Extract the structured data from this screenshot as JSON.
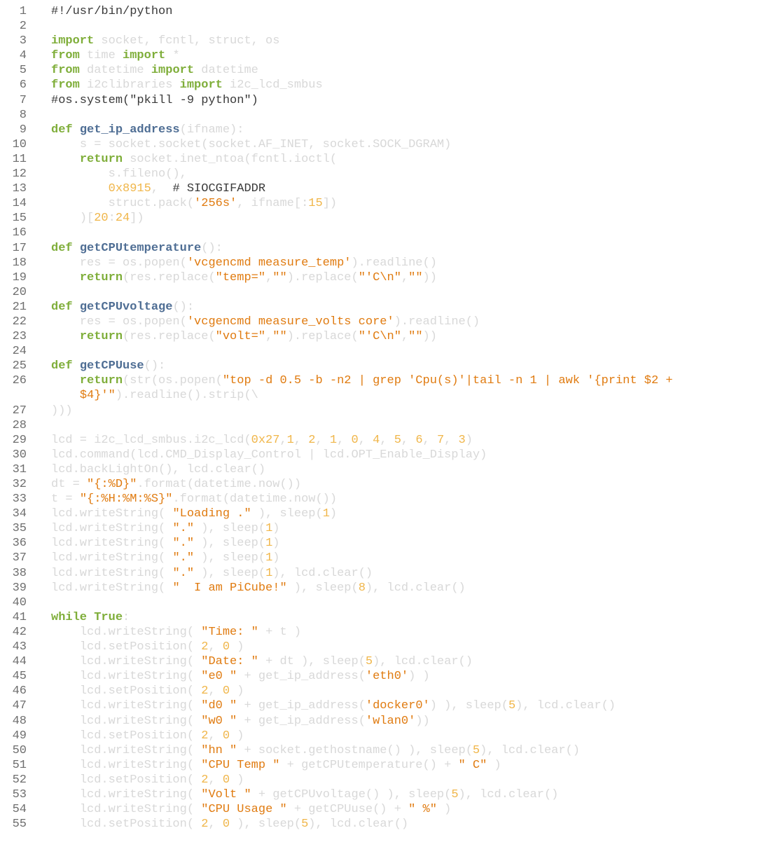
{
  "editor": {
    "colors": {
      "background": "#ffffff",
      "line_number": "#6e6e6e",
      "keyword": "#7fae3a",
      "function_name": "#4f6e94",
      "string": "#e07b10",
      "number": "#f0b64a",
      "comment": "#3a3a3a",
      "plain": "#d8d8d8"
    },
    "lines": [
      {
        "n": "1",
        "indent": 0,
        "t": [
          [
            "#!/usr/bin/python",
            "c"
          ]
        ]
      },
      {
        "n": "2",
        "indent": 0,
        "t": []
      },
      {
        "n": "3",
        "indent": 0,
        "t": [
          [
            "import",
            "k"
          ],
          [
            " socket, fcntl, struct, os",
            "p"
          ]
        ]
      },
      {
        "n": "4",
        "indent": 0,
        "t": [
          [
            "from",
            "k"
          ],
          [
            " time ",
            "p"
          ],
          [
            "import",
            "k"
          ],
          [
            " *",
            "p"
          ]
        ]
      },
      {
        "n": "5",
        "indent": 0,
        "t": [
          [
            "from",
            "k"
          ],
          [
            " datetime ",
            "p"
          ],
          [
            "import",
            "k"
          ],
          [
            " datetime",
            "p"
          ]
        ]
      },
      {
        "n": "6",
        "indent": 0,
        "t": [
          [
            "from",
            "k"
          ],
          [
            " i2clibraries ",
            "p"
          ],
          [
            "import",
            "k"
          ],
          [
            " i2c_lcd_smbus",
            "p"
          ]
        ]
      },
      {
        "n": "7",
        "indent": 0,
        "t": [
          [
            "#os.system(\"pkill -9 python\")",
            "c"
          ]
        ]
      },
      {
        "n": "8",
        "indent": 0,
        "t": []
      },
      {
        "n": "9",
        "indent": 0,
        "t": [
          [
            "def",
            "k"
          ],
          [
            " ",
            "p"
          ],
          [
            "get_ip_address",
            "f"
          ],
          [
            "(ifname):",
            "p"
          ]
        ]
      },
      {
        "n": "10",
        "indent": 4,
        "t": [
          [
            "s = socket.socket(socket.AF_INET, socket.SOCK_DGRAM)",
            "p"
          ]
        ]
      },
      {
        "n": "11",
        "indent": 4,
        "t": [
          [
            "return",
            "k"
          ],
          [
            " socket.inet_ntoa(fcntl.ioctl(",
            "p"
          ]
        ]
      },
      {
        "n": "12",
        "indent": 8,
        "t": [
          [
            "s.fileno(),",
            "p"
          ]
        ]
      },
      {
        "n": "13",
        "indent": 8,
        "t": [
          [
            "0x8915",
            "n"
          ],
          [
            ",  ",
            "p"
          ],
          [
            "# SIOCGIFADDR",
            "c"
          ]
        ]
      },
      {
        "n": "14",
        "indent": 8,
        "t": [
          [
            "struct.pack(",
            "p"
          ],
          [
            "'256s'",
            "s"
          ],
          [
            ", ifname[:",
            "p"
          ],
          [
            "15",
            "n"
          ],
          [
            "])",
            "p"
          ]
        ]
      },
      {
        "n": "15",
        "indent": 4,
        "t": [
          [
            ")[",
            "p"
          ],
          [
            "20",
            "n"
          ],
          [
            ":",
            "p"
          ],
          [
            "24",
            "n"
          ],
          [
            "])",
            "p"
          ]
        ]
      },
      {
        "n": "16",
        "indent": 0,
        "t": []
      },
      {
        "n": "17",
        "indent": 0,
        "t": [
          [
            "def",
            "k"
          ],
          [
            " ",
            "p"
          ],
          [
            "getCPUtemperature",
            "f"
          ],
          [
            "():",
            "p"
          ]
        ]
      },
      {
        "n": "18",
        "indent": 4,
        "t": [
          [
            "res = os.popen(",
            "p"
          ],
          [
            "'vcgencmd measure_temp'",
            "s"
          ],
          [
            ").readline()",
            "p"
          ]
        ]
      },
      {
        "n": "19",
        "indent": 4,
        "t": [
          [
            "return",
            "k"
          ],
          [
            "(res.replace(",
            "p"
          ],
          [
            "\"temp=\"",
            "s"
          ],
          [
            ",",
            "p"
          ],
          [
            "\"\"",
            "s"
          ],
          [
            ").replace(",
            "p"
          ],
          [
            "\"'C\\n\"",
            "s"
          ],
          [
            ",",
            "p"
          ],
          [
            "\"\"",
            "s"
          ],
          [
            "))",
            "p"
          ]
        ]
      },
      {
        "n": "20",
        "indent": 0,
        "t": []
      },
      {
        "n": "21",
        "indent": 0,
        "t": [
          [
            "def",
            "k"
          ],
          [
            " ",
            "p"
          ],
          [
            "getCPUvoltage",
            "f"
          ],
          [
            "():",
            "p"
          ]
        ]
      },
      {
        "n": "22",
        "indent": 4,
        "t": [
          [
            "res = os.popen(",
            "p"
          ],
          [
            "'vcgencmd measure_volts core'",
            "s"
          ],
          [
            ").readline()",
            "p"
          ]
        ]
      },
      {
        "n": "23",
        "indent": 4,
        "t": [
          [
            "return",
            "k"
          ],
          [
            "(res.replace(",
            "p"
          ],
          [
            "\"volt=\"",
            "s"
          ],
          [
            ",",
            "p"
          ],
          [
            "\"\"",
            "s"
          ],
          [
            ").replace(",
            "p"
          ],
          [
            "\"'C\\n\"",
            "s"
          ],
          [
            ",",
            "p"
          ],
          [
            "\"\"",
            "s"
          ],
          [
            "))",
            "p"
          ]
        ]
      },
      {
        "n": "24",
        "indent": 0,
        "t": []
      },
      {
        "n": "25",
        "indent": 0,
        "t": [
          [
            "def",
            "k"
          ],
          [
            " ",
            "p"
          ],
          [
            "getCPUuse",
            "f"
          ],
          [
            "():",
            "p"
          ]
        ]
      },
      {
        "n": "26",
        "indent": 4,
        "t": [
          [
            "return",
            "k"
          ],
          [
            "(str(os.popen(",
            "p"
          ],
          [
            "\"top -d 0.5 -b -n2 | grep 'Cpu(s)'|tail -n 1 | awk '{print $2 +",
            "s"
          ]
        ]
      },
      {
        "n": "",
        "indent": 4,
        "t": [
          [
            "$4}'\"",
            "s"
          ],
          [
            ").readline().strip(\\",
            "p"
          ]
        ]
      },
      {
        "n": "27",
        "indent": 0,
        "t": [
          [
            ")))",
            "p"
          ]
        ]
      },
      {
        "n": "28",
        "indent": 0,
        "t": []
      },
      {
        "n": "29",
        "indent": 0,
        "t": [
          [
            "lcd = i2c_lcd_smbus.i2c_lcd(",
            "p"
          ],
          [
            "0x27",
            "n"
          ],
          [
            ",",
            "p"
          ],
          [
            "1",
            "n"
          ],
          [
            ", ",
            "p"
          ],
          [
            "2",
            "n"
          ],
          [
            ", ",
            "p"
          ],
          [
            "1",
            "n"
          ],
          [
            ", ",
            "p"
          ],
          [
            "0",
            "n"
          ],
          [
            ", ",
            "p"
          ],
          [
            "4",
            "n"
          ],
          [
            ", ",
            "p"
          ],
          [
            "5",
            "n"
          ],
          [
            ", ",
            "p"
          ],
          [
            "6",
            "n"
          ],
          [
            ", ",
            "p"
          ],
          [
            "7",
            "n"
          ],
          [
            ", ",
            "p"
          ],
          [
            "3",
            "n"
          ],
          [
            ")",
            "p"
          ]
        ]
      },
      {
        "n": "30",
        "indent": 0,
        "t": [
          [
            "lcd.command(lcd.CMD_Display_Control | lcd.OPT_Enable_Display)",
            "p"
          ]
        ]
      },
      {
        "n": "31",
        "indent": 0,
        "t": [
          [
            "lcd.backLightOn(), lcd.clear()",
            "p"
          ]
        ]
      },
      {
        "n": "32",
        "indent": 0,
        "t": [
          [
            "dt = ",
            "p"
          ],
          [
            "\"{:%D}\"",
            "s"
          ],
          [
            ".format(datetime.now())",
            "p"
          ]
        ]
      },
      {
        "n": "33",
        "indent": 0,
        "t": [
          [
            "t = ",
            "p"
          ],
          [
            "\"{:%H:%M:%S}\"",
            "s"
          ],
          [
            ".format(datetime.now())",
            "p"
          ]
        ]
      },
      {
        "n": "34",
        "indent": 0,
        "t": [
          [
            "lcd.writeString( ",
            "p"
          ],
          [
            "\"Loading .\"",
            "s"
          ],
          [
            " ), sleep(",
            "p"
          ],
          [
            "1",
            "n"
          ],
          [
            ")",
            "p"
          ]
        ]
      },
      {
        "n": "35",
        "indent": 0,
        "t": [
          [
            "lcd.writeString( ",
            "p"
          ],
          [
            "\".\"",
            "s"
          ],
          [
            " ), sleep(",
            "p"
          ],
          [
            "1",
            "n"
          ],
          [
            ")",
            "p"
          ]
        ]
      },
      {
        "n": "36",
        "indent": 0,
        "t": [
          [
            "lcd.writeString( ",
            "p"
          ],
          [
            "\".\"",
            "s"
          ],
          [
            " ), sleep(",
            "p"
          ],
          [
            "1",
            "n"
          ],
          [
            ")",
            "p"
          ]
        ]
      },
      {
        "n": "37",
        "indent": 0,
        "t": [
          [
            "lcd.writeString( ",
            "p"
          ],
          [
            "\".\"",
            "s"
          ],
          [
            " ), sleep(",
            "p"
          ],
          [
            "1",
            "n"
          ],
          [
            ")",
            "p"
          ]
        ]
      },
      {
        "n": "38",
        "indent": 0,
        "t": [
          [
            "lcd.writeString( ",
            "p"
          ],
          [
            "\".\"",
            "s"
          ],
          [
            " ), sleep(",
            "p"
          ],
          [
            "1",
            "n"
          ],
          [
            "), lcd.clear()",
            "p"
          ]
        ]
      },
      {
        "n": "39",
        "indent": 0,
        "t": [
          [
            "lcd.writeString( ",
            "p"
          ],
          [
            "\"  I am PiCube!\"",
            "s"
          ],
          [
            " ), sleep(",
            "p"
          ],
          [
            "8",
            "n"
          ],
          [
            "), lcd.clear()",
            "p"
          ]
        ]
      },
      {
        "n": "40",
        "indent": 0,
        "t": []
      },
      {
        "n": "41",
        "indent": 0,
        "t": [
          [
            "while",
            "k"
          ],
          [
            " ",
            "p"
          ],
          [
            "True",
            "k"
          ],
          [
            ":",
            "p"
          ]
        ]
      },
      {
        "n": "42",
        "indent": 4,
        "t": [
          [
            "lcd.writeString( ",
            "p"
          ],
          [
            "\"Time: \"",
            "s"
          ],
          [
            " + t )",
            "p"
          ]
        ]
      },
      {
        "n": "43",
        "indent": 4,
        "t": [
          [
            "lcd.setPosition( ",
            "p"
          ],
          [
            "2",
            "n"
          ],
          [
            ", ",
            "p"
          ],
          [
            "0",
            "n"
          ],
          [
            " )",
            "p"
          ]
        ]
      },
      {
        "n": "44",
        "indent": 4,
        "t": [
          [
            "lcd.writeString( ",
            "p"
          ],
          [
            "\"Date: \"",
            "s"
          ],
          [
            " + dt ), sleep(",
            "p"
          ],
          [
            "5",
            "n"
          ],
          [
            "), lcd.clear()",
            "p"
          ]
        ]
      },
      {
        "n": "45",
        "indent": 4,
        "t": [
          [
            "lcd.writeString( ",
            "p"
          ],
          [
            "\"e0 \"",
            "s"
          ],
          [
            " + get_ip_address(",
            "p"
          ],
          [
            "'eth0'",
            "s"
          ],
          [
            ") )",
            "p"
          ]
        ]
      },
      {
        "n": "46",
        "indent": 4,
        "t": [
          [
            "lcd.setPosition( ",
            "p"
          ],
          [
            "2",
            "n"
          ],
          [
            ", ",
            "p"
          ],
          [
            "0",
            "n"
          ],
          [
            " )",
            "p"
          ]
        ]
      },
      {
        "n": "47",
        "indent": 4,
        "t": [
          [
            "lcd.writeString( ",
            "p"
          ],
          [
            "\"d0 \"",
            "s"
          ],
          [
            " + get_ip_address(",
            "p"
          ],
          [
            "'docker0'",
            "s"
          ],
          [
            ") ), sleep(",
            "p"
          ],
          [
            "5",
            "n"
          ],
          [
            "), lcd.clear()",
            "p"
          ]
        ]
      },
      {
        "n": "48",
        "indent": 4,
        "t": [
          [
            "lcd.writeString( ",
            "p"
          ],
          [
            "\"w0 \"",
            "s"
          ],
          [
            " + get_ip_address(",
            "p"
          ],
          [
            "'wlan0'",
            "s"
          ],
          [
            "))",
            "p"
          ]
        ]
      },
      {
        "n": "49",
        "indent": 4,
        "t": [
          [
            "lcd.setPosition( ",
            "p"
          ],
          [
            "2",
            "n"
          ],
          [
            ", ",
            "p"
          ],
          [
            "0",
            "n"
          ],
          [
            " )",
            "p"
          ]
        ]
      },
      {
        "n": "50",
        "indent": 4,
        "t": [
          [
            "lcd.writeString( ",
            "p"
          ],
          [
            "\"hn \"",
            "s"
          ],
          [
            " + socket.gethostname() ), sleep(",
            "p"
          ],
          [
            "5",
            "n"
          ],
          [
            "), lcd.clear()",
            "p"
          ]
        ]
      },
      {
        "n": "51",
        "indent": 4,
        "t": [
          [
            "lcd.writeString( ",
            "p"
          ],
          [
            "\"CPU Temp \"",
            "s"
          ],
          [
            " + getCPUtemperature() + ",
            "p"
          ],
          [
            "\" C\"",
            "s"
          ],
          [
            " )",
            "p"
          ]
        ]
      },
      {
        "n": "52",
        "indent": 4,
        "t": [
          [
            "lcd.setPosition( ",
            "p"
          ],
          [
            "2",
            "n"
          ],
          [
            ", ",
            "p"
          ],
          [
            "0",
            "n"
          ],
          [
            " )",
            "p"
          ]
        ]
      },
      {
        "n": "53",
        "indent": 4,
        "t": [
          [
            "lcd.writeString( ",
            "p"
          ],
          [
            "\"Volt \"",
            "s"
          ],
          [
            " + getCPUvoltage() ), sleep(",
            "p"
          ],
          [
            "5",
            "n"
          ],
          [
            "), lcd.clear()",
            "p"
          ]
        ]
      },
      {
        "n": "54",
        "indent": 4,
        "t": [
          [
            "lcd.writeString( ",
            "p"
          ],
          [
            "\"CPU Usage \"",
            "s"
          ],
          [
            " + getCPUuse() + ",
            "p"
          ],
          [
            "\" %\"",
            "s"
          ],
          [
            " )",
            "p"
          ]
        ]
      },
      {
        "n": "55",
        "indent": 4,
        "t": [
          [
            "lcd.setPosition( ",
            "p"
          ],
          [
            "2",
            "n"
          ],
          [
            ", ",
            "p"
          ],
          [
            "0",
            "n"
          ],
          [
            " ), sleep(",
            "p"
          ],
          [
            "5",
            "n"
          ],
          [
            "), lcd.clear()",
            "p"
          ]
        ]
      }
    ]
  }
}
